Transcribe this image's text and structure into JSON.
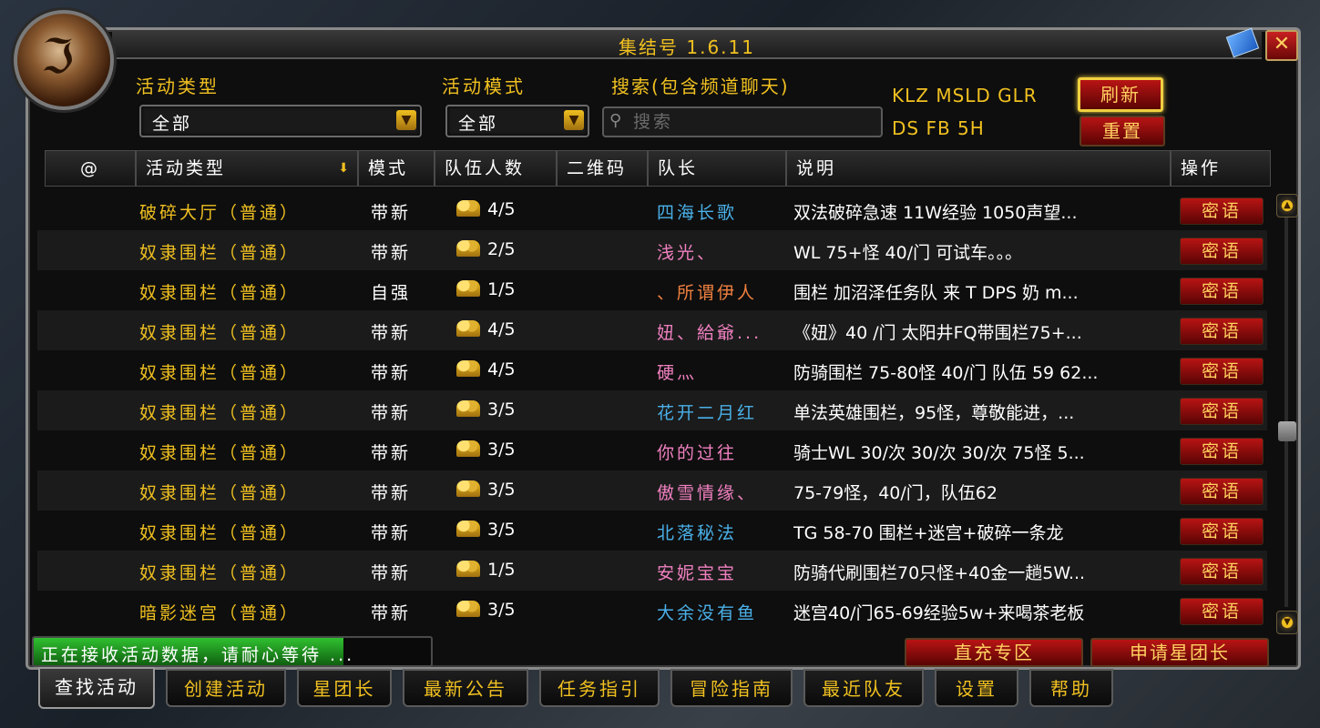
{
  "window": {
    "title": "集结号 1.6.11",
    "close_label": "✕"
  },
  "filters": {
    "activity_type_label": "活动类型",
    "activity_type_value": "全部",
    "activity_mode_label": "活动模式",
    "activity_mode_value": "全部",
    "search_label": "搜索(包含频道聊天)",
    "search_placeholder": "搜索"
  },
  "quick_tags": {
    "line1": "KLZ MSLD GLR",
    "line2": "DS FB 5H"
  },
  "buttons": {
    "refresh": "刷新",
    "reset": "重置",
    "recharge": "直充专区",
    "apply_star": "申请星团长"
  },
  "table": {
    "headers": [
      "@",
      "活动类型",
      "模式",
      "队伍人数",
      "二维码",
      "队长",
      "说明",
      "操作"
    ],
    "whisper_label": "密语",
    "rows": [
      {
        "type": "破碎大厅（普通）",
        "mode": "带新",
        "count": "4/5",
        "leader": "四海长歌",
        "leader_color": "#4ab0e8",
        "desc": "双法破碎急速 11W经验 1050声望..."
      },
      {
        "type": "奴隶围栏（普通）",
        "mode": "带新",
        "count": "2/5",
        "leader": "浅光、",
        "leader_color": "#f080c0",
        "desc": "WL 75+怪 40/门 可试车。。。"
      },
      {
        "type": "奴隶围栏（普通）",
        "mode": "自强",
        "count": "1/5",
        "leader": "、所谓伊人",
        "leader_color": "#f08040",
        "desc": "围栏 加沼泽任务队 来 T DPS 奶 m..."
      },
      {
        "type": "奴隶围栏（普通）",
        "mode": "带新",
        "count": "4/5",
        "leader": "妞、給爺...",
        "leader_color": "#f080c0",
        "desc": "《妞》40 /门 太阳井FQ带围栏75+..."
      },
      {
        "type": "奴隶围栏（普通）",
        "mode": "带新",
        "count": "4/5",
        "leader": "硬灬",
        "leader_color": "#f080c0",
        "desc": "防骑围栏 75-80怪 40/门 队伍 59 62..."
      },
      {
        "type": "奴隶围栏（普通）",
        "mode": "带新",
        "count": "3/5",
        "leader": "花开二月红",
        "leader_color": "#4ab0e8",
        "desc": "单法英雄围栏，95怪，尊敬能进，..."
      },
      {
        "type": "奴隶围栏（普通）",
        "mode": "带新",
        "count": "3/5",
        "leader": "你的过往",
        "leader_color": "#f080c0",
        "desc": "骑士WL 30/次 30/次 30/次 75怪 5..."
      },
      {
        "type": "奴隶围栏（普通）",
        "mode": "带新",
        "count": "3/5",
        "leader": "傲雪情缘、",
        "leader_color": "#f080c0",
        "desc": "75-79怪，40/门，队伍62"
      },
      {
        "type": "奴隶围栏（普通）",
        "mode": "带新",
        "count": "3/5",
        "leader": "北落秘法",
        "leader_color": "#4ab0e8",
        "desc": "TG 58-70 围栏+迷宫+破碎一条龙"
      },
      {
        "type": "奴隶围栏（普通）",
        "mode": "带新",
        "count": "1/5",
        "leader": "安妮宝宝",
        "leader_color": "#f080c0",
        "desc": "防骑代刷围栏70只怪+40金一趟5W..."
      },
      {
        "type": "暗影迷宫（普通）",
        "mode": "带新",
        "count": "3/5",
        "leader": "大余没有鱼",
        "leader_color": "#4ab0e8",
        "desc": "迷宫40/门65-69经验5w+来喝茶老板"
      }
    ]
  },
  "status": {
    "text": "正在接收活动数据，请耐心等待 ...",
    "progress": 0.78
  },
  "tabs": [
    "查找活动",
    "创建活动",
    "星团长",
    "最新公告",
    "任务指引",
    "冒险指南",
    "最近队友",
    "设置",
    "帮助"
  ],
  "active_tab": 0
}
